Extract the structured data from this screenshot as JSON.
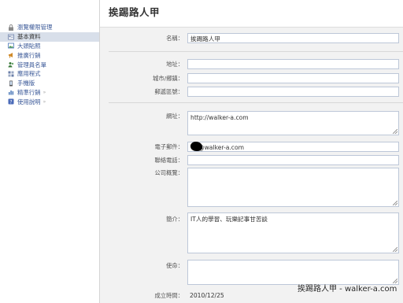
{
  "sidebar": {
    "items": [
      {
        "label": "瀏覽權限管理",
        "icon": "lock-icon"
      },
      {
        "label": "基本資料",
        "icon": "info-card-icon",
        "active": true
      },
      {
        "label": "大頭貼照",
        "icon": "photo-icon"
      },
      {
        "label": "推廣行銷",
        "icon": "megaphone-icon"
      },
      {
        "label": "管理員名單",
        "icon": "admins-icon"
      },
      {
        "label": "應用程式",
        "icon": "apps-icon"
      },
      {
        "label": "手機版",
        "icon": "mobile-icon"
      },
      {
        "label": "精準行銷",
        "icon": "chart-icon",
        "more": "»"
      },
      {
        "label": "使用說明",
        "icon": "help-icon",
        "more": "»"
      }
    ]
  },
  "page": {
    "title": "挨踢路人甲"
  },
  "form": {
    "name": {
      "label": "名稱：",
      "value": "挨踢路人甲"
    },
    "address": {
      "label": "地址：",
      "value": ""
    },
    "city": {
      "label": "城市/鄉鎮：",
      "value": ""
    },
    "zip": {
      "label": "郵遞區號：",
      "value": ""
    },
    "website": {
      "label": "網址：",
      "value": "http://walker-a.com"
    },
    "email": {
      "label": "電子郵件：",
      "value": "@walker-a.com"
    },
    "phone": {
      "label": "聯絡電話：",
      "value": ""
    },
    "overview": {
      "label": "公司概覽：",
      "value": ""
    },
    "bio": {
      "label": "簡介：",
      "value": "IT人的學習、玩樂記事甘苦談"
    },
    "mission": {
      "label": "使命：",
      "value": ""
    },
    "founded": {
      "label": "成立時間：",
      "value": "2010/12/25"
    }
  },
  "watermark": "挨踢路人甲 - walker-a.com",
  "colors": {
    "link": "#3b5998",
    "active_bg": "#d8dfea",
    "input_border": "#bdc7d8"
  }
}
